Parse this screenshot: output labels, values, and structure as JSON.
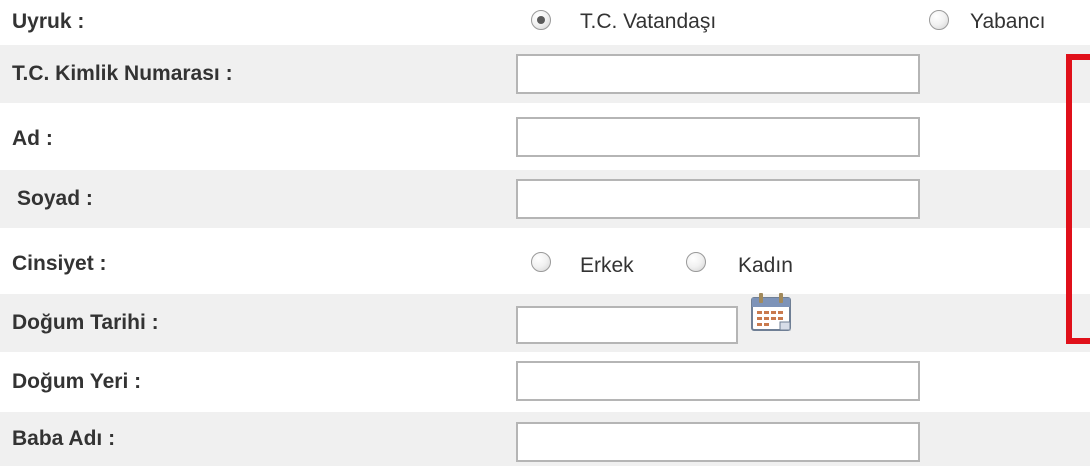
{
  "form": {
    "uyruk": {
      "label": "Uyruk :",
      "options": [
        {
          "label": "T.C. Vatandaşı",
          "selected": true
        },
        {
          "label": "Yabancı",
          "selected": false
        }
      ]
    },
    "tc_kimlik": {
      "label": "T.C. Kimlik Numarası :",
      "value": ""
    },
    "ad": {
      "label": "Ad :",
      "value": ""
    },
    "soyad": {
      "label": "Soyad :",
      "value": ""
    },
    "cinsiyet": {
      "label": "Cinsiyet :",
      "options": [
        {
          "label": "Erkek",
          "selected": false
        },
        {
          "label": "Kadın",
          "selected": false
        }
      ]
    },
    "dogum_tarihi": {
      "label": "Doğum Tarihi :",
      "value": "",
      "icon": "calendar-icon"
    },
    "dogum_yeri": {
      "label": "Doğum Yeri :",
      "value": ""
    },
    "baba_adi": {
      "label": "Baba Adı :",
      "value": ""
    }
  },
  "colors": {
    "row_shade": "#f0f0f0",
    "label_text": "#333333",
    "input_border": "#b5b5b5",
    "highlight_box": "#e0101a"
  }
}
